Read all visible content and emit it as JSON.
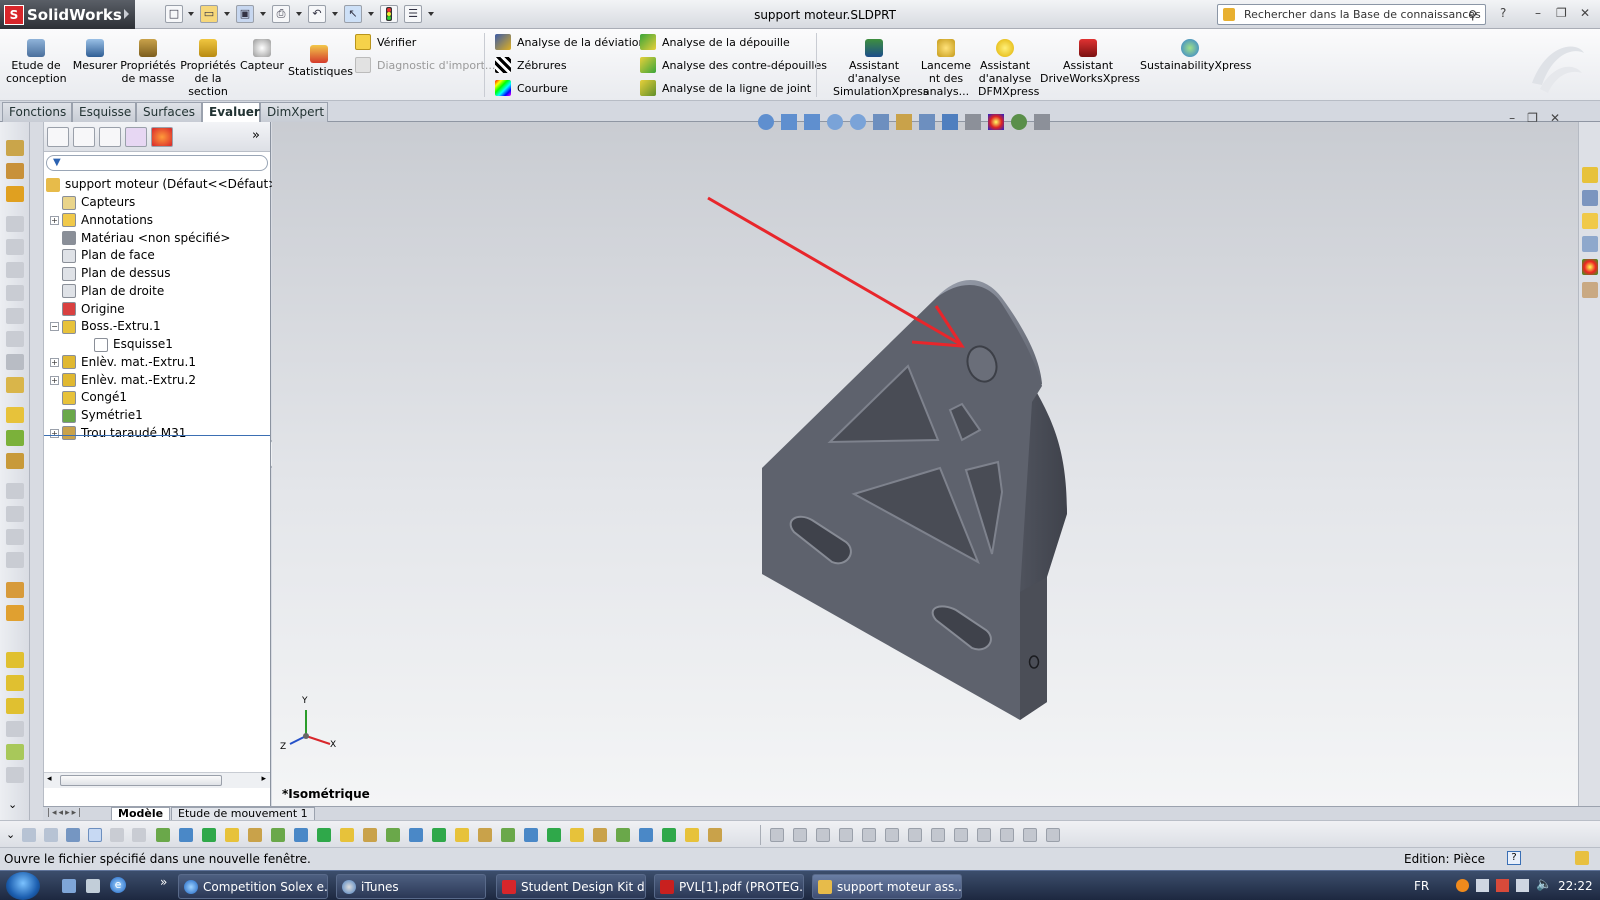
{
  "app": {
    "brand": "SolidWorks",
    "document_title": "support moteur.SLDPRT",
    "window_controls": [
      "?",
      "–",
      "❐",
      "✕"
    ]
  },
  "search": {
    "placeholder": "Rechercher dans la Base de connaissances"
  },
  "command_manager": {
    "big_buttons": [
      {
        "label": "Etude de conception",
        "icon": "design-study-icon"
      },
      {
        "label": "Mesurer",
        "icon": "measure-icon"
      },
      {
        "label": "Propriétés de masse",
        "icon": "mass-properties-icon"
      },
      {
        "label": "Propriétés de la section",
        "icon": "section-properties-icon"
      },
      {
        "label": "Capteur",
        "icon": "sensor-icon"
      },
      {
        "label": "Statistiques",
        "icon": "statistics-icon"
      }
    ],
    "check_items": [
      {
        "label": "Vérifier",
        "enabled": true
      },
      {
        "label": "Diagnostic d'import...",
        "enabled": false
      }
    ],
    "analysis_col1": [
      "Analyse de la déviation",
      "Zébrures",
      "Courbure"
    ],
    "analysis_col2": [
      "Analyse de la dépouille",
      "Analyse des contre-dépouilles",
      "Analyse de la ligne de joint"
    ],
    "xpress_buttons": [
      {
        "label": "Assistant d'analyse SimulationXpress"
      },
      {
        "label": "Lanceme nt des analys..."
      },
      {
        "label": "Assistant d'analyse DFMXpress"
      },
      {
        "label": "Assistant DriveWorksXpress"
      },
      {
        "label": "SustainabilityXpress"
      }
    ]
  },
  "tabs": [
    {
      "label": "Fonctions",
      "active": false
    },
    {
      "label": "Esquisse",
      "active": false
    },
    {
      "label": "Surfaces",
      "active": false
    },
    {
      "label": "Evaluer",
      "active": true
    },
    {
      "label": "DimXpert",
      "active": false
    }
  ],
  "feature_tree": {
    "root": "support moteur  (Défaut<<Défaut>_Et",
    "items": [
      {
        "label": "Capteurs",
        "expandable": false,
        "indent": 0,
        "icon": "sensor-folder-icon"
      },
      {
        "label": "Annotations",
        "expandable": true,
        "indent": 0,
        "icon": "annotations-icon"
      },
      {
        "label": "Matériau <non spécifié>",
        "expandable": false,
        "indent": 0,
        "icon": "material-icon"
      },
      {
        "label": "Plan de face",
        "expandable": false,
        "indent": 0,
        "icon": "plane-icon"
      },
      {
        "label": "Plan de dessus",
        "expandable": false,
        "indent": 0,
        "icon": "plane-icon"
      },
      {
        "label": "Plan de droite",
        "expandable": false,
        "indent": 0,
        "icon": "plane-icon"
      },
      {
        "label": "Origine",
        "expandable": false,
        "indent": 0,
        "icon": "origin-icon"
      },
      {
        "label": "Boss.-Extru.1",
        "expandable": true,
        "expanded": true,
        "indent": 0,
        "icon": "extrude-icon"
      },
      {
        "label": "Esquisse1",
        "expandable": false,
        "indent": 1,
        "icon": "sketch-icon"
      },
      {
        "label": "Enlèv. mat.-Extru.1",
        "expandable": true,
        "indent": 0,
        "icon": "cut-extrude-icon"
      },
      {
        "label": "Enlèv. mat.-Extru.2",
        "expandable": true,
        "indent": 0,
        "icon": "cut-extrude-icon"
      },
      {
        "label": "Congé1",
        "expandable": false,
        "indent": 0,
        "icon": "fillet-icon"
      },
      {
        "label": "Symétrie1",
        "expandable": false,
        "indent": 0,
        "icon": "mirror-icon"
      },
      {
        "label": "Trou taraudé M31",
        "expandable": true,
        "indent": 0,
        "icon": "tapped-hole-icon"
      }
    ]
  },
  "viewport": {
    "view_name": "*Isométrique",
    "axes": {
      "x": "X",
      "y": "Y",
      "z": "Z"
    }
  },
  "bottom_tabs": [
    "Modèle",
    "Etude de mouvement 1"
  ],
  "status_bar": {
    "message": "Ouvre le fichier spécifié dans une nouvelle fenêtre.",
    "mode": "Edition: Pièce"
  },
  "taskbar": {
    "buttons": [
      {
        "label": "Competition Solex e...",
        "active": false
      },
      {
        "label": "iTunes",
        "active": false
      },
      {
        "label": "Student Design Kit d...",
        "active": false
      },
      {
        "label": "PVL[1].pdf (PROTEG...",
        "active": false
      },
      {
        "label": "support moteur ass...",
        "active": true
      }
    ],
    "language": "FR",
    "clock": "22:22"
  },
  "colors": {
    "arrow": "#e8262b",
    "part": "#5e626d",
    "part_light": "#7a7e89",
    "part_dark": "#3f424b"
  }
}
